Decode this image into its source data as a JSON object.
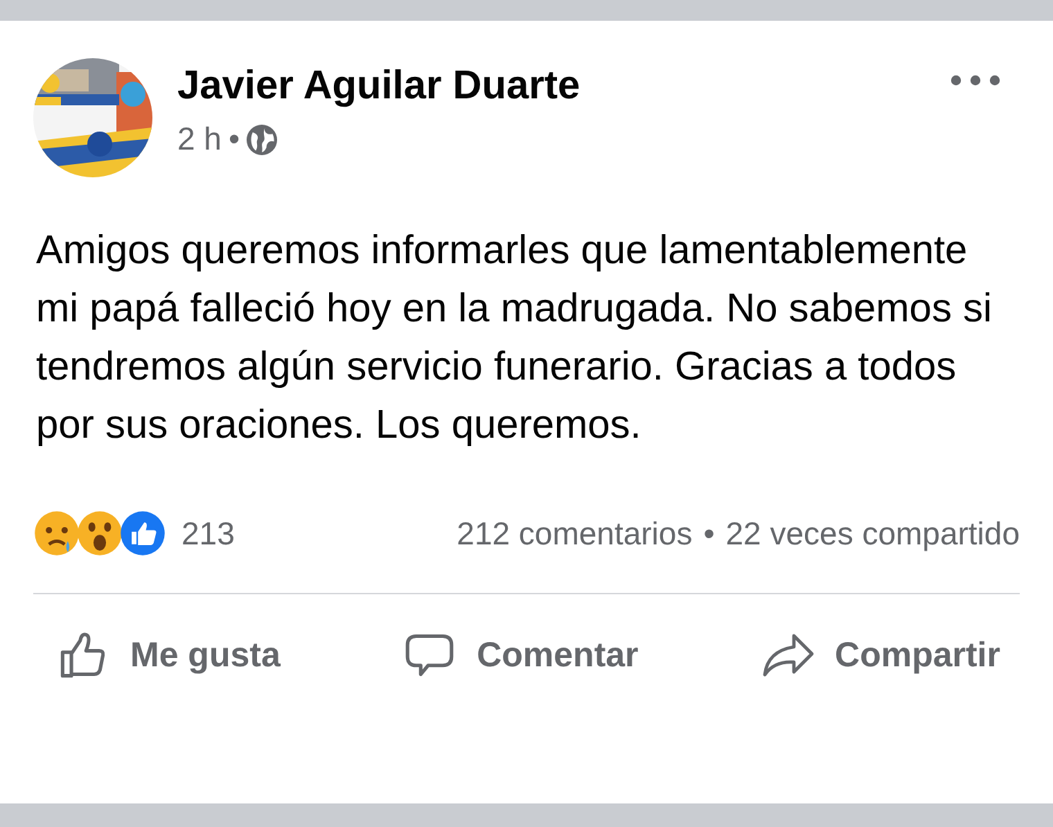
{
  "post": {
    "author": "Javier Aguilar Duarte",
    "time": "2 h",
    "separator": "•",
    "text": "Amigos queremos informarles que lamentablemente mi papá falleció hoy en la madrugada. No sabemos si tendremos algún servicio funerario. Gracias a todos por sus oraciones. Los queremos."
  },
  "stats": {
    "reactions_count": "213",
    "comments": "212 comentarios",
    "separator": "•",
    "shares": "22 veces compartido"
  },
  "actions": [
    {
      "kind": "like",
      "label": "Me gusta"
    },
    {
      "kind": "comment",
      "label": "Comentar"
    },
    {
      "kind": "share",
      "label": "Compartir"
    }
  ]
}
